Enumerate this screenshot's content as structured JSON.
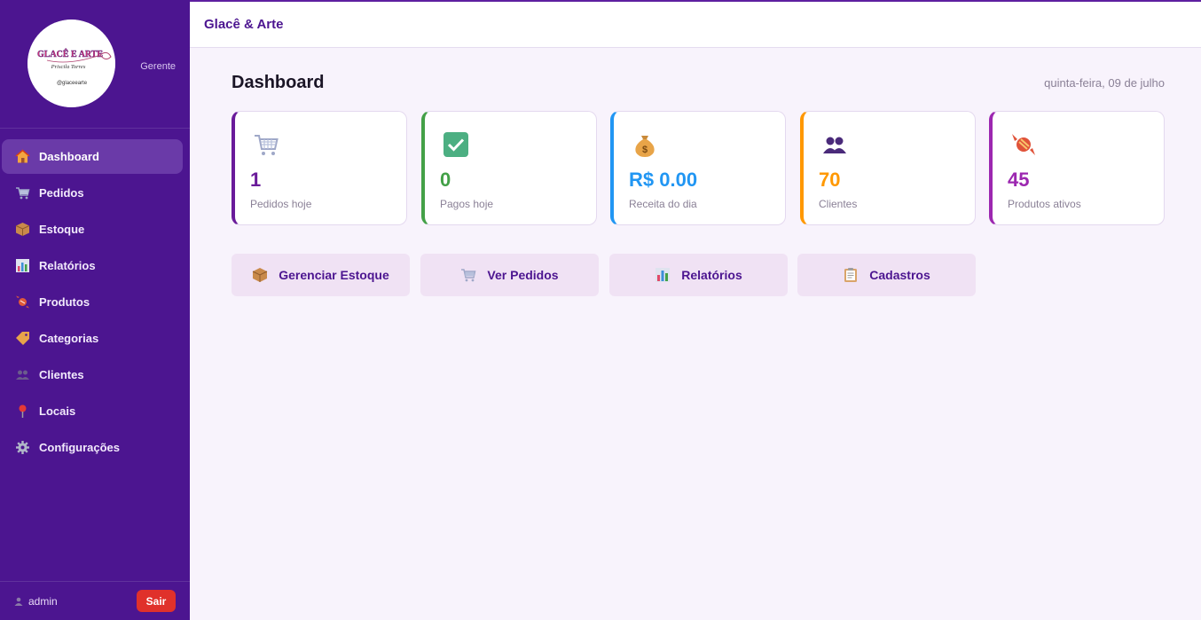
{
  "app": {
    "title": "Glacê & Arte"
  },
  "sidebar": {
    "logo": {
      "line1": "GLACÊ E ARTE",
      "line2": "Priscila Torres",
      "line3": "@glaceearte"
    },
    "role": "Gerente",
    "items": [
      {
        "label": "Dashboard",
        "icon": "house-icon",
        "active": true
      },
      {
        "label": "Pedidos",
        "icon": "cart-icon"
      },
      {
        "label": "Estoque",
        "icon": "box-icon"
      },
      {
        "label": "Relatórios",
        "icon": "bar-chart-icon"
      },
      {
        "label": "Produtos",
        "icon": "candy-icon"
      },
      {
        "label": "Categorias",
        "icon": "tag-icon"
      },
      {
        "label": "Clientes",
        "icon": "users-icon"
      },
      {
        "label": "Locais",
        "icon": "pin-icon"
      },
      {
        "label": "Configurações",
        "icon": "gear-icon"
      }
    ],
    "user": "admin",
    "logout": "Sair"
  },
  "page": {
    "title": "Dashboard",
    "date": "quinta-feira, 09 de julho"
  },
  "cards": [
    {
      "value": "1",
      "label": "Pedidos hoje",
      "icon": "cart-icon",
      "color": "#6a1b9a"
    },
    {
      "value": "0",
      "label": "Pagos hoje",
      "icon": "check-icon",
      "color": "#43a047"
    },
    {
      "value": "R$ 0.00",
      "label": "Receita do dia",
      "icon": "money-bag-icon",
      "color": "#2196f3"
    },
    {
      "value": "70",
      "label": "Clientes",
      "icon": "users-icon",
      "color": "#ff9800"
    },
    {
      "value": "45",
      "label": "Produtos ativos",
      "icon": "candy-icon",
      "color": "#9c27b0"
    }
  ],
  "actions": [
    {
      "label": "Gerenciar Estoque",
      "icon": "box-icon"
    },
    {
      "label": "Ver Pedidos",
      "icon": "cart-icon"
    },
    {
      "label": "Relatórios",
      "icon": "bar-chart-icon"
    },
    {
      "label": "Cadastros",
      "icon": "clipboard-icon"
    }
  ]
}
